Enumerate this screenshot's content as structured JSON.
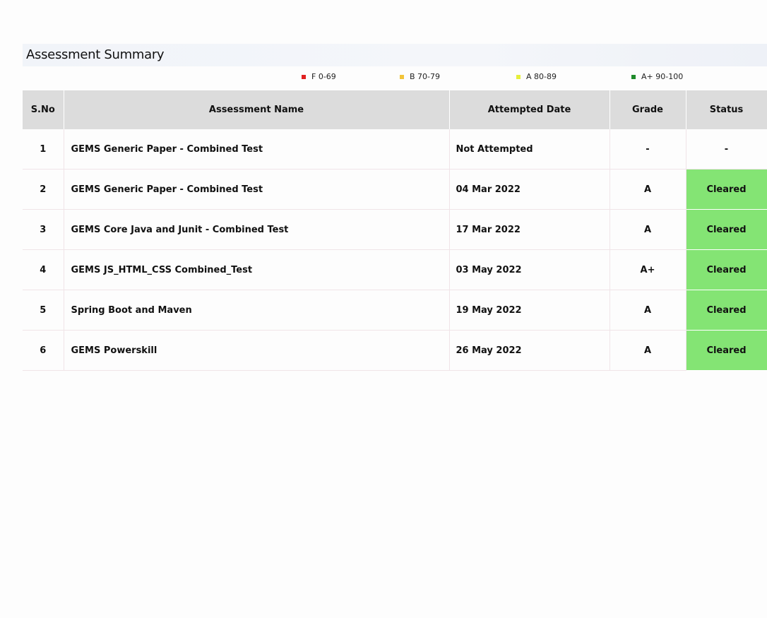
{
  "page": {
    "title": "Assessment Summary"
  },
  "legend": [
    {
      "label": "F 0-69",
      "color": "#e02020"
    },
    {
      "label": "B 70-79",
      "color": "#f2c43a"
    },
    {
      "label": "A 80-89",
      "color": "#e6ef3c"
    },
    {
      "label": "A+ 90-100",
      "color": "#1e8a2a"
    }
  ],
  "table": {
    "headers": {
      "sno": "S.No",
      "name": "Assessment Name",
      "date": "Attempted Date",
      "grade": "Grade",
      "status": "Status"
    },
    "rows": [
      {
        "sno": "1",
        "name": "GEMS Generic Paper - Combined Test",
        "date": "Not Attempted",
        "grade": "-",
        "status": "-"
      },
      {
        "sno": "2",
        "name": "GEMS Generic Paper - Combined Test",
        "date": "04 Mar 2022",
        "grade": "A",
        "status": "Cleared"
      },
      {
        "sno": "3",
        "name": "GEMS Core Java and Junit - Combined Test",
        "date": "17 Mar 2022",
        "grade": "A",
        "status": "Cleared"
      },
      {
        "sno": "4",
        "name": "GEMS JS_HTML_CSS Combined_Test",
        "date": "03 May 2022",
        "grade": "A+",
        "status": "Cleared"
      },
      {
        "sno": "5",
        "name": "Spring Boot and Maven",
        "date": "19 May 2022",
        "grade": "A",
        "status": "Cleared"
      },
      {
        "sno": "6",
        "name": "GEMS Powerskill",
        "date": "26 May 2022",
        "grade": "A",
        "status": "Cleared"
      }
    ]
  },
  "colors": {
    "cleared_bg": "#84e474",
    "header_bg": "#dcdcdc"
  }
}
